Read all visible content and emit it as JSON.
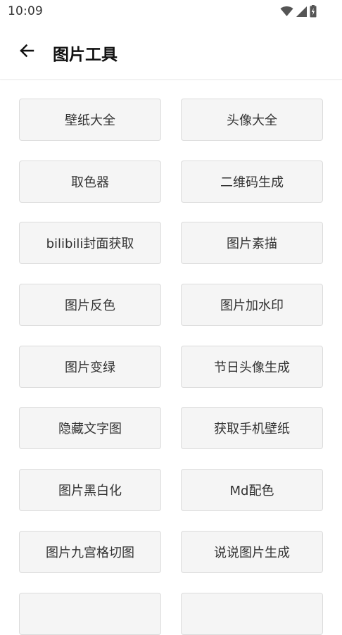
{
  "status_bar": {
    "time": "10:09",
    "icons": [
      "wifi-icon",
      "signal-icon",
      "battery-icon"
    ]
  },
  "app_bar": {
    "back_icon": "arrow-left-icon",
    "title": "图片工具"
  },
  "tools": [
    {
      "label": "壁纸大全"
    },
    {
      "label": "头像大全"
    },
    {
      "label": "取色器"
    },
    {
      "label": "二维码生成"
    },
    {
      "label": "bilibili封面获取"
    },
    {
      "label": "图片素描"
    },
    {
      "label": "图片反色"
    },
    {
      "label": "图片加水印"
    },
    {
      "label": "图片变绿"
    },
    {
      "label": "节日头像生成"
    },
    {
      "label": "隐藏文字图"
    },
    {
      "label": "获取手机壁纸"
    },
    {
      "label": "图片黑白化"
    },
    {
      "label": "Md配色"
    },
    {
      "label": "图片九宫格切图"
    },
    {
      "label": "说说图片生成"
    },
    {
      "label": ""
    },
    {
      "label": ""
    }
  ],
  "colors": {
    "button_background": "#f5f5f5",
    "button_border": "#dcdcdc",
    "text": "#333333"
  }
}
